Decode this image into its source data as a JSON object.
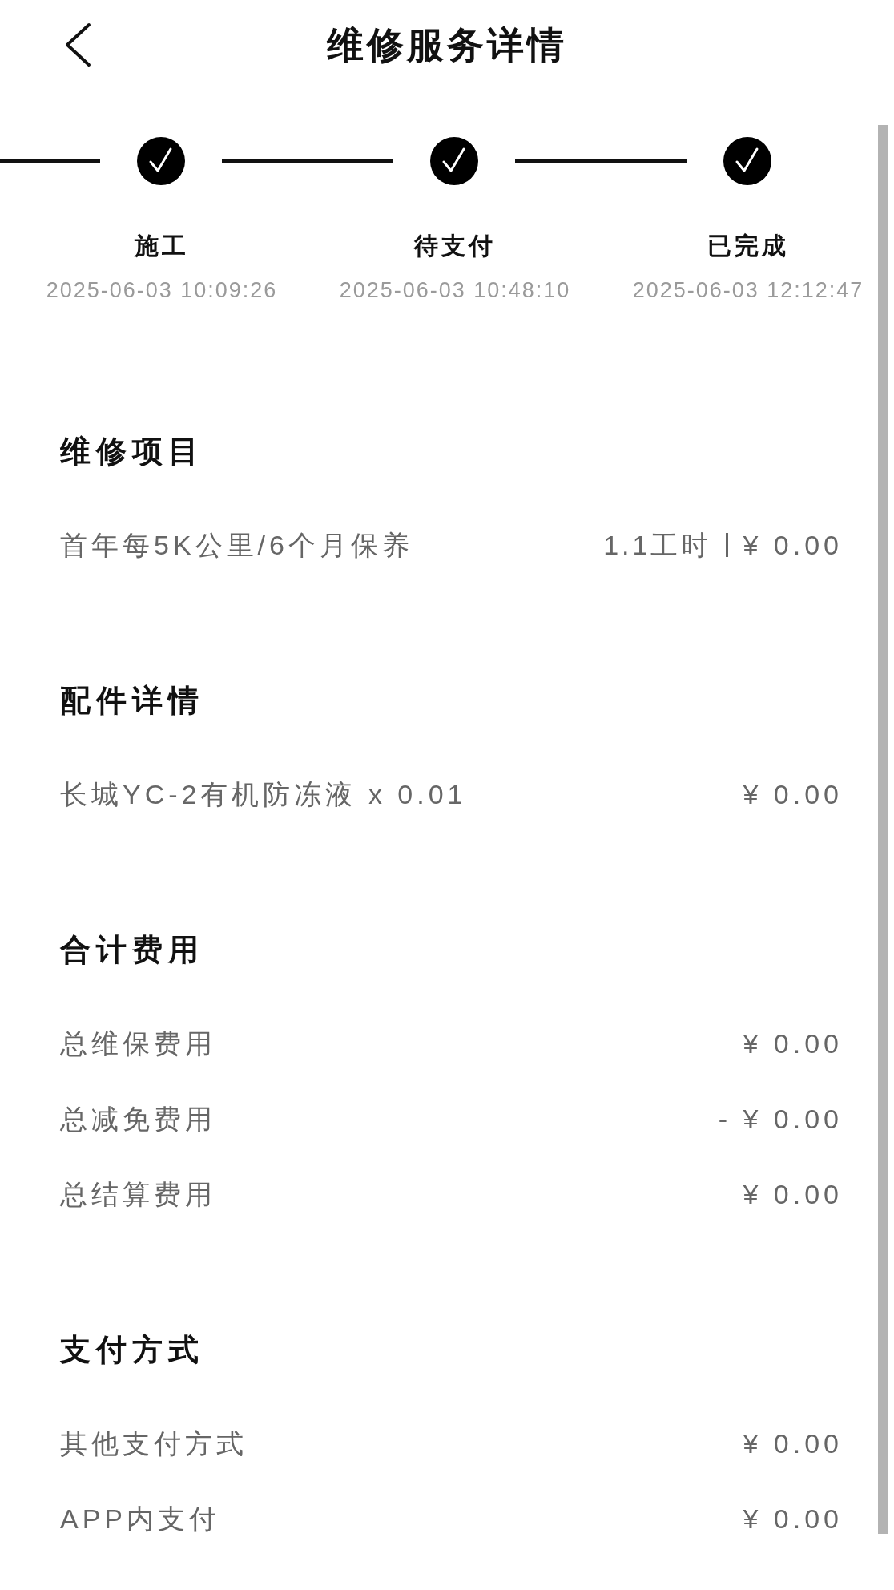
{
  "header": {
    "title": "维修服务详情"
  },
  "progress": {
    "steps": [
      {
        "label": "施工",
        "time": "2025-06-03 10:09:26",
        "completed": true
      },
      {
        "label": "待支付",
        "time": "2025-06-03 10:48:10",
        "completed": true
      },
      {
        "label": "已完成",
        "time": "2025-06-03 12:12:47",
        "completed": true
      }
    ]
  },
  "sections": [
    {
      "title": "维修项目",
      "rows": [
        {
          "label": "首年每5K公里/6个月保养",
          "hours": "1.1工时",
          "amount": "¥ 0.00"
        }
      ]
    },
    {
      "title": "配件详情",
      "rows": [
        {
          "label": "长城YC-2有机防冻液 x 0.01",
          "amount": "¥ 0.00"
        }
      ]
    },
    {
      "title": "合计费用",
      "rows": [
        {
          "label": "总维保费用",
          "amount": "¥ 0.00"
        },
        {
          "label": "总减免费用",
          "amount": "- ¥ 0.00"
        },
        {
          "label": "总结算费用",
          "amount": "¥ 0.00"
        }
      ]
    },
    {
      "title": "支付方式",
      "rows": [
        {
          "label": "其他支付方式",
          "amount": "¥ 0.00"
        },
        {
          "label": "APP内支付",
          "amount": "¥ 0.00"
        }
      ]
    }
  ]
}
